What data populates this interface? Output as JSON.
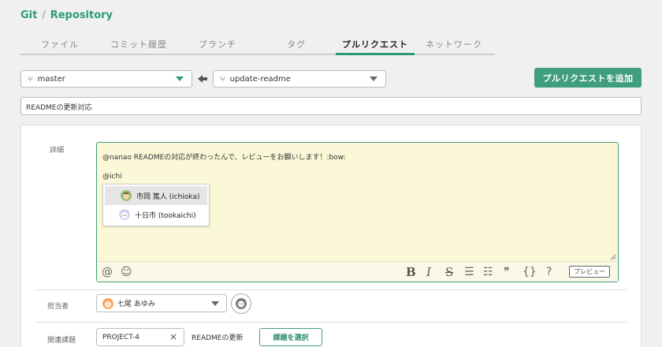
{
  "breadcrumb": {
    "root": "Git",
    "separator": "/",
    "current": "Repository"
  },
  "tabs": [
    {
      "label": "ファイル"
    },
    {
      "label": "コミット履歴"
    },
    {
      "label": "ブランチ"
    },
    {
      "label": "タグ"
    },
    {
      "label": "プルリクエスト",
      "active": true
    },
    {
      "label": "ネットワーク"
    }
  ],
  "branches": {
    "base": "master",
    "compare": "update-readme"
  },
  "add_pr_button": "プルリクエストを追加",
  "pr_title": "READMEの更新対応",
  "details": {
    "label": "詳細",
    "line1": "@nanao READMEの対応が終わったんで、レビューをお願いします！:bow:",
    "line2": "@ichi",
    "mentions": [
      {
        "name": "市岡 篤人 (ichioka)",
        "selected": true
      },
      {
        "name": "十日市 (tookaichi)",
        "selected": false
      }
    ],
    "toolbar": {
      "mention": "@",
      "emoji": "☺",
      "bold": "B",
      "italic": "I",
      "strike": "S",
      "ul": "☰",
      "ol": "☷",
      "quote": "❞",
      "code": "{}",
      "help": "?",
      "preview": "プレビュー"
    }
  },
  "assignee": {
    "label": "担当者",
    "value": "七尾 あゆみ"
  },
  "related_issue": {
    "label": "関連課題",
    "key": "PROJECT-4",
    "clear": "×",
    "title": "READMEの更新",
    "select_button": "課題を選択"
  },
  "colors": {
    "accent": "#3f9e7f",
    "editor_bg": "#fbf8d8"
  }
}
